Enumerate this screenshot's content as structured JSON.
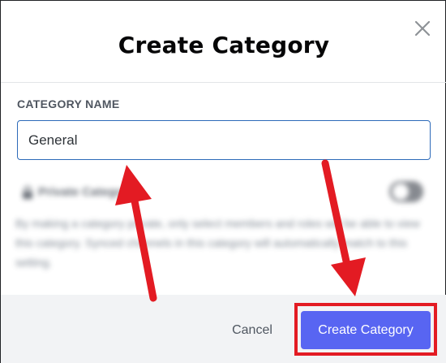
{
  "dialog": {
    "title": "Create Category",
    "close_icon": "close-icon"
  },
  "form": {
    "label": "CATEGORY NAME",
    "name_value": "General"
  },
  "private": {
    "label": "Private Category",
    "description": "By making a category private, only select members and roles will be able to view this category. Synced channels in this category will automatically match to this setting.",
    "lock_icon": "lock-icon",
    "toggle_on": false
  },
  "footer": {
    "cancel_label": "Cancel",
    "create_label": "Create Category"
  },
  "colors": {
    "accent": "#5865f2",
    "annotation": "#e31b23",
    "input_border": "#2d6ab9",
    "footer_bg": "#f2f3f5"
  }
}
